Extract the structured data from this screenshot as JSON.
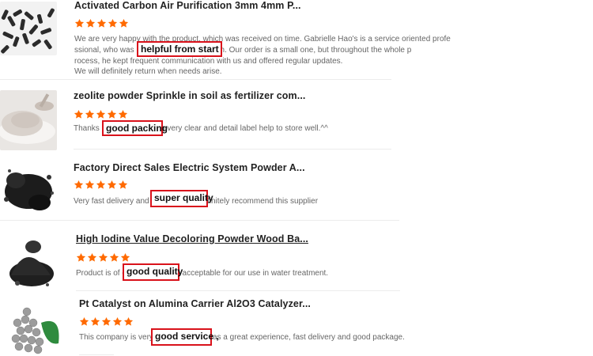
{
  "colors": {
    "star": "#ff6a00",
    "highlight_border": "#d9121b",
    "title": "#222222",
    "body": "#666666"
  },
  "rating_max": 5,
  "reviews": [
    {
      "title": "Activated Carbon Air Purification 3mm 4mm P...",
      "rating": 5,
      "text_lines": [
        "We are very happy with the product, which was received on time. Gabrielle Hao's is a service oriented profe",
        "ssional, who was helpful from start to finish. Our order is a small one, but throughout the whole p",
        "rocess, he kept frequent communication with us and offered regular updates.",
        "We will definitely return when needs arise."
      ],
      "highlight": "helpful from start",
      "thumb_icon": "black-pellets-image"
    },
    {
      "title": "zeolite powder Sprinkle in soil as fertilizer com...",
      "rating": 5,
      "text_lines": [
        "Thanks good packing with very clear and detail label help to store well.^^"
      ],
      "highlight": "good packing",
      "thumb_icon": "white-powder-image"
    },
    {
      "title": "Factory Direct Sales Electric System Powder A...",
      "rating": 5,
      "text_lines": [
        "Very fast delivery and super quality definitely recommend this supplier"
      ],
      "highlight": "super quality",
      "thumb_icon": "black-powder-image"
    },
    {
      "title": "High Iodine Value Decoloring Powder Wood Ba...",
      "rating": 5,
      "text_lines": [
        "Product is of good quality and acceptable for our use in water treatment."
      ],
      "highlight": "good quality",
      "thumb_icon": "black-powder-pile-image"
    },
    {
      "title": "Pt Catalyst on Alumina Carrier Al2O3 Catalyzer...",
      "rating": 5,
      "text_lines": [
        "This company is very good service , was a great experience, fast delivery and good package."
      ],
      "highlight": "good service ,",
      "thumb_icon": "grey-spheres-image"
    }
  ]
}
